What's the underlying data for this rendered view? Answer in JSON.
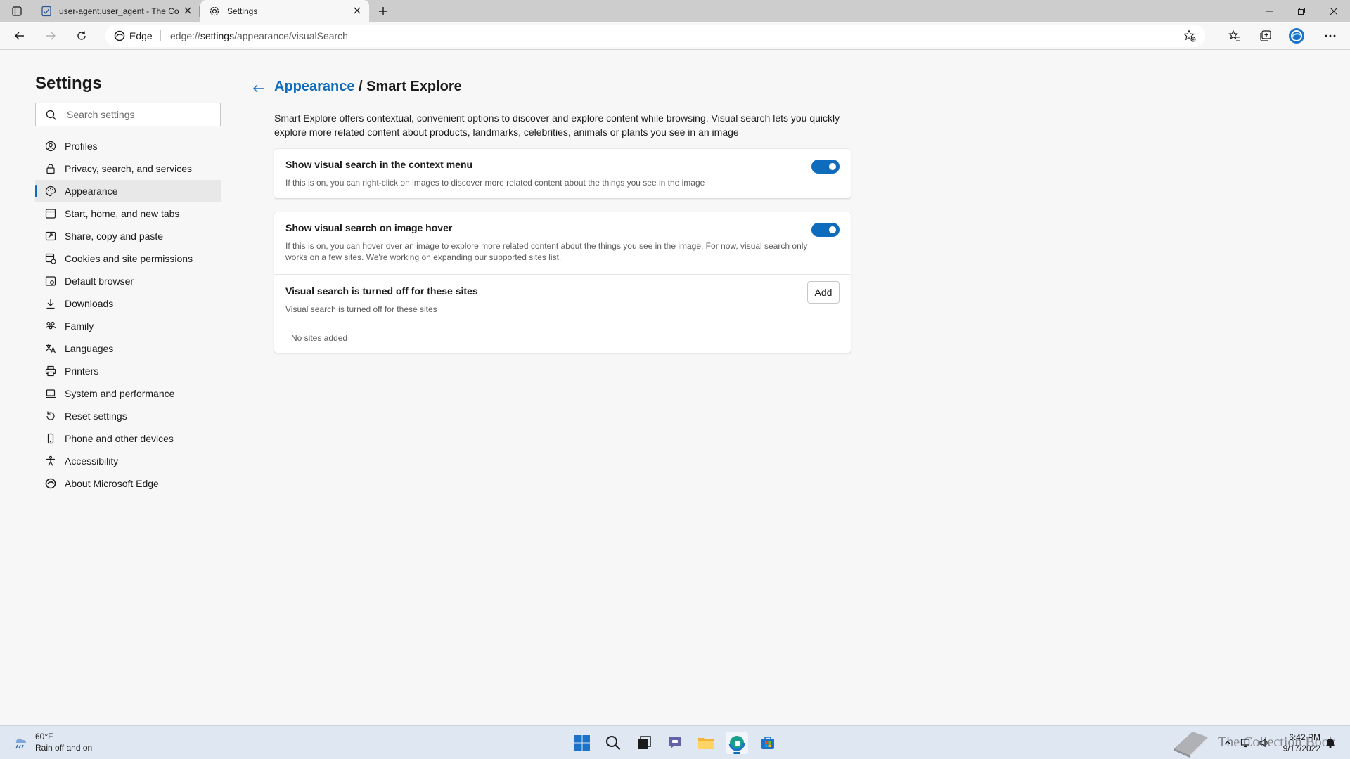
{
  "browser": {
    "tabs": [
      {
        "title": "user-agent.user_agent - The Coll",
        "icon": "document-icon",
        "active": false
      },
      {
        "title": "Settings",
        "icon": "gear-icon",
        "active": true
      }
    ],
    "address": {
      "site_label": "Edge",
      "url_prefix": "edge://",
      "url_highlight": "settings",
      "url_suffix": "/appearance/visualSearch"
    },
    "accent": "#0f6cbd"
  },
  "sidebar": {
    "title": "Settings",
    "search_placeholder": "Search settings",
    "items": [
      {
        "label": "Profiles",
        "icon": "profile-icon"
      },
      {
        "label": "Privacy, search, and services",
        "icon": "lock-icon"
      },
      {
        "label": "Appearance",
        "icon": "palette-icon",
        "active": true
      },
      {
        "label": "Start, home, and new tabs",
        "icon": "home-tabs-icon"
      },
      {
        "label": "Share, copy and paste",
        "icon": "share-icon"
      },
      {
        "label": "Cookies and site permissions",
        "icon": "cookie-icon"
      },
      {
        "label": "Default browser",
        "icon": "browser-icon"
      },
      {
        "label": "Downloads",
        "icon": "download-icon"
      },
      {
        "label": "Family",
        "icon": "family-icon"
      },
      {
        "label": "Languages",
        "icon": "language-icon"
      },
      {
        "label": "Printers",
        "icon": "printer-icon"
      },
      {
        "label": "System and performance",
        "icon": "laptop-icon"
      },
      {
        "label": "Reset settings",
        "icon": "reset-icon"
      },
      {
        "label": "Phone and other devices",
        "icon": "phone-icon"
      },
      {
        "label": "Accessibility",
        "icon": "accessibility-icon"
      },
      {
        "label": "About Microsoft Edge",
        "icon": "edge-icon"
      }
    ]
  },
  "main": {
    "breadcrumb_parent": "Appearance",
    "breadcrumb_sep": " / ",
    "breadcrumb_current": "Smart Explore",
    "description": "Smart Explore offers contextual, convenient options to discover and explore content while browsing. Visual search lets you quickly explore more related content about products, landmarks, celebrities, animals or plants you see in an image",
    "context_menu": {
      "title": "Show visual search in the context menu",
      "subtitle": "If this is on, you can right-click on images to discover more related content about the things you see in the image",
      "enabled": true
    },
    "hover": {
      "title": "Show visual search on image hover",
      "subtitle": "If this is on, you can hover over an image to explore more related content about the things you see in the image. For now, visual search only works on a few sites. We're working on expanding our supported sites list.",
      "enabled": true
    },
    "blocked_sites": {
      "title": "Visual search is turned off for these sites",
      "subtitle": "Visual search is turned off for these sites",
      "add_label": "Add",
      "empty_label": "No sites added"
    }
  },
  "taskbar": {
    "weather_temp": "60°F",
    "weather_desc": "Rain off and on",
    "time": "6:42 PM",
    "date": "9/17/2022",
    "watermark": "The Collection Book"
  }
}
